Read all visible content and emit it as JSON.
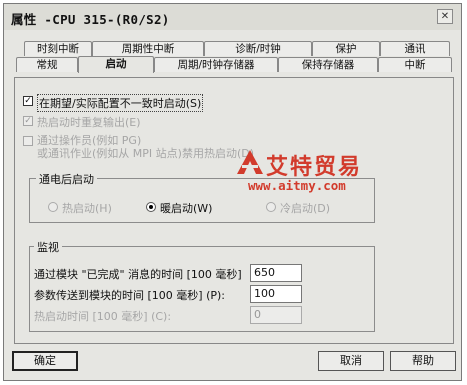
{
  "window": {
    "title": "属性 -CPU 315-(R0/S2)",
    "close_glyph": "✕"
  },
  "tabs": {
    "row1": [
      {
        "label": "时刻中断"
      },
      {
        "label": "周期性中断"
      },
      {
        "label": "诊断/时钟"
      },
      {
        "label": "保护"
      },
      {
        "label": "通讯"
      }
    ],
    "row2": [
      {
        "label": "常规"
      },
      {
        "label": "启动",
        "active": true
      },
      {
        "label": "周期/时钟存储器"
      },
      {
        "label": "保持存储器"
      },
      {
        "label": "中断"
      }
    ]
  },
  "options": {
    "startup_mismatch": {
      "label": "在期望/实际配置不一致时启动(S)",
      "checked": true
    },
    "hot_restart_reset_output": {
      "label": "热启动时重复输出(E)",
      "checked": true,
      "disabled": true
    },
    "disable_manual_hot_restart": {
      "label": "通过操作员(例如 PG)\n或通讯作业(例如从 MPI 站点)禁用热启动(D)",
      "checked": false,
      "disabled": true
    }
  },
  "power_on_group": {
    "title": "通电后启动",
    "radios": [
      {
        "label": "热启动(H)",
        "checked": false,
        "disabled": true
      },
      {
        "label": "暖启动(W)",
        "checked": true,
        "disabled": false
      },
      {
        "label": "冷启动(D)",
        "checked": false,
        "disabled": true
      }
    ]
  },
  "monitor_group": {
    "title": "监视",
    "rows": [
      {
        "label": "通过模块 \"已完成\" 消息的时间 [100 毫秒]",
        "value": "650",
        "disabled": false
      },
      {
        "label": "参数传送到模块的时间 [100 毫秒] (P):",
        "value": "100",
        "disabled": false
      },
      {
        "label": "热启动时间 [100 毫秒] (C):",
        "value": "0",
        "disabled": true
      }
    ]
  },
  "buttons": {
    "ok": "确定",
    "cancel": "取消",
    "help": "帮助"
  },
  "watermark": {
    "brand": "艾特贸易",
    "url": "www.aitmy.com",
    "color": "#d23b2c"
  }
}
